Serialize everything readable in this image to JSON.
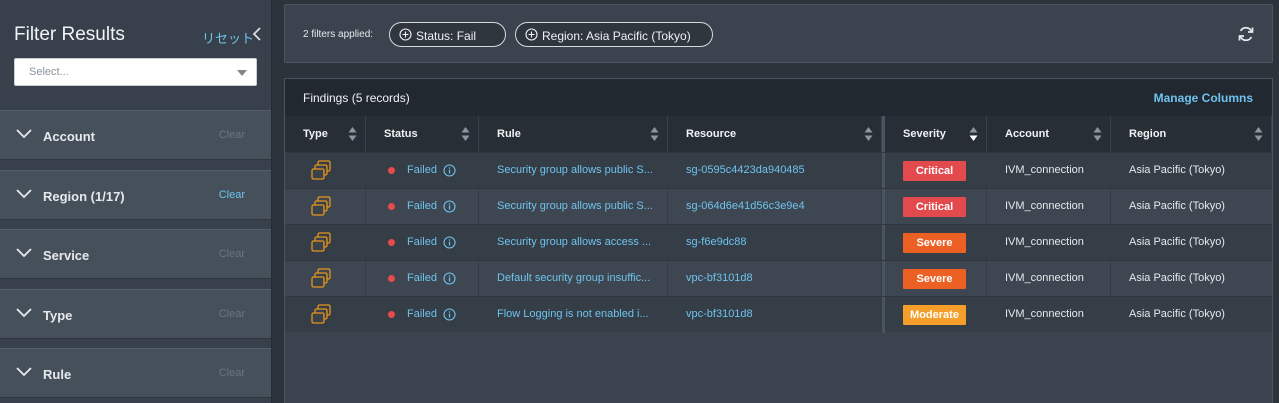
{
  "sidebar": {
    "title": "Filter Results",
    "reset_label": "リセット",
    "select_placeholder": "Select...",
    "facets": [
      {
        "label": "Account",
        "clear": "Clear",
        "active": false
      },
      {
        "label": "Region (1/17)",
        "clear": "Clear",
        "active": true
      },
      {
        "label": "Service",
        "clear": "Clear",
        "active": false
      },
      {
        "label": "Type",
        "clear": "Clear",
        "active": false
      },
      {
        "label": "Rule",
        "clear": "Clear",
        "active": false
      }
    ]
  },
  "filterbar": {
    "applied_label": "2 filters applied:",
    "chips": [
      "Status: Fail",
      "Region: Asia Pacific (Tokyo)"
    ]
  },
  "findings": {
    "title": "Findings (5 records)",
    "manage_columns": "Manage Columns",
    "columns": [
      "Type",
      "Status",
      "Rule",
      "Resource",
      "Severity",
      "Account",
      "Region"
    ],
    "rows": [
      {
        "status": "Failed",
        "rule": "Security group allows public S...",
        "resource": "sg-0595c4423da940485",
        "severity": "Critical",
        "account": "IVM_connection",
        "region": "Asia Pacific (Tokyo)"
      },
      {
        "status": "Failed",
        "rule": "Security group allows public S...",
        "resource": "sg-064d6e41d56c3e9e4",
        "severity": "Critical",
        "account": "IVM_connection",
        "region": "Asia Pacific (Tokyo)"
      },
      {
        "status": "Failed",
        "rule": "Security group allows access ...",
        "resource": "sg-f6e9dc88",
        "severity": "Severe",
        "account": "IVM_connection",
        "region": "Asia Pacific (Tokyo)"
      },
      {
        "status": "Failed",
        "rule": "Default security group insuffic...",
        "resource": "vpc-bf3101d8",
        "severity": "Severe",
        "account": "IVM_connection",
        "region": "Asia Pacific (Tokyo)"
      },
      {
        "status": "Failed",
        "rule": "Flow Logging is not enabled i...",
        "resource": "vpc-bf3101d8",
        "severity": "Moderate",
        "account": "IVM_connection",
        "region": "Asia Pacific (Tokyo)"
      }
    ]
  },
  "colors": {
    "accent": "#6ec3ee",
    "failed_dot": "#e9494b",
    "critical": "#e34a4d",
    "severe": "#ec6024",
    "moderate": "#f59f2a",
    "type_icon": "#e8951c"
  },
  "icons": {
    "collapse": "chevron-left-icon",
    "facet_toggle": "chevron-down-icon",
    "chip": "plus-circle-icon",
    "refresh": "refresh-icon",
    "sort": "sort-icon",
    "status_info": "info-icon",
    "type": "resource-stack-icon"
  }
}
